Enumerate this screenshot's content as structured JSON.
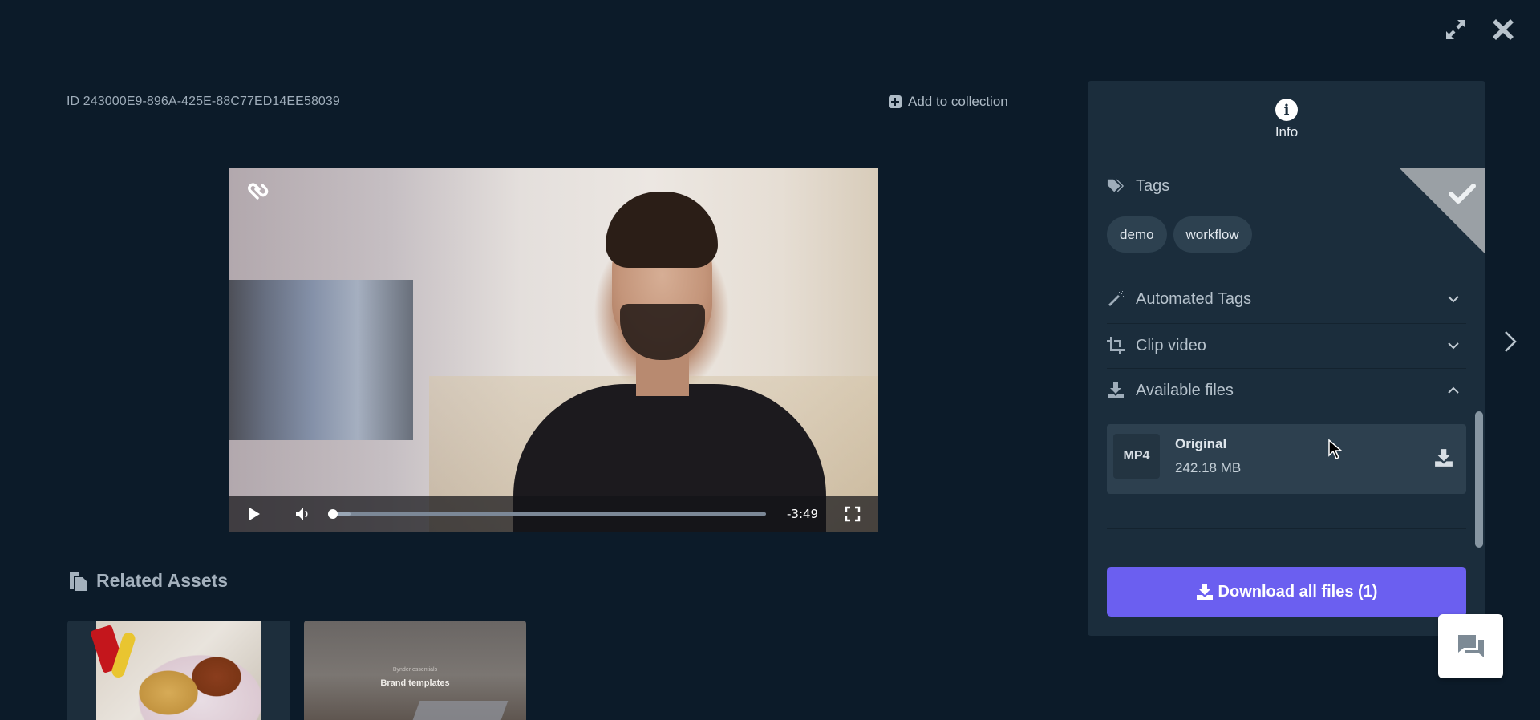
{
  "window": {
    "expand_label": "expand-icon",
    "close_label": "close-icon"
  },
  "asset": {
    "id_text": "ID 243000E9-896A-425E-88C77ED14EE58039",
    "add_to_collection": "Add to collection"
  },
  "player": {
    "time_remaining": "-3:49",
    "progress_fraction": 0.0,
    "buffered_fraction": 0.04,
    "icons": [
      "brand-logo-icon",
      "play-icon",
      "volume-icon",
      "fullscreen-icon"
    ]
  },
  "related": {
    "title": "Related Assets",
    "items": [
      {
        "kind": "image",
        "description": "food plate photo"
      },
      {
        "kind": "video",
        "caption_small": "Bynder essentials",
        "caption": "Brand templates"
      }
    ]
  },
  "panel": {
    "tab_label": "Info",
    "approved": true,
    "tags": {
      "title": "Tags",
      "items": [
        "demo",
        "workflow"
      ]
    },
    "sections": [
      {
        "title": "Automated Tags",
        "icon": "magic-wand-icon",
        "expanded": false
      },
      {
        "title": "Clip video",
        "icon": "crop-icon",
        "expanded": false
      },
      {
        "title": "Available files",
        "icon": "download-icon",
        "expanded": true
      }
    ],
    "files": [
      {
        "format": "MP4",
        "name": "Original",
        "size": "242.18 MB"
      }
    ],
    "download_all_label": "Download all files (1)",
    "accent_color": "#6b5ff0"
  }
}
